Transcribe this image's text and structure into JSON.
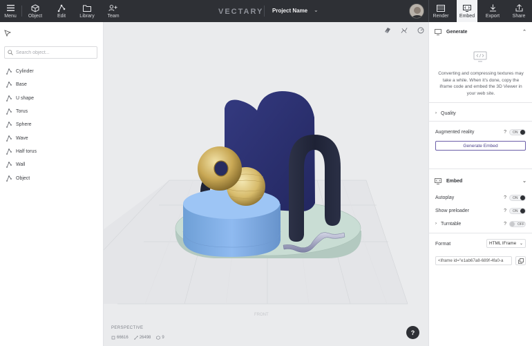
{
  "toolbar": {
    "menu_label": "Menu",
    "object_label": "Object",
    "edit_label": "Edit",
    "library_label": "Library",
    "team_label": "Team",
    "logo": "VECTARY",
    "project_name": "Project Name",
    "render_label": "Render",
    "embed_label": "Embed",
    "export_label": "Export",
    "share_label": "Share"
  },
  "left_panel": {
    "search_placeholder": "Search object...",
    "objects": [
      {
        "label": "Cylinder"
      },
      {
        "label": "Base"
      },
      {
        "label": "U shape"
      },
      {
        "label": "Torus"
      },
      {
        "label": "Sphere"
      },
      {
        "label": "Wave"
      },
      {
        "label": "Half torus"
      },
      {
        "label": "Wall"
      },
      {
        "label": "Object"
      }
    ]
  },
  "viewport": {
    "camera": "PERSPECTIVE",
    "front_label": "FRONT",
    "stats": {
      "vertices": "66616",
      "edges": "26498",
      "objects": "9"
    },
    "help_label": "?"
  },
  "right_panel": {
    "generate": {
      "title": "Generate",
      "description": "Converting and compressing textures may take a while. When it's done, copy the iframe code and embed the 3D Viewer in your web site.",
      "quality_label": "Quality",
      "ar_label": "Augmented reality",
      "ar_state": "ON",
      "help": "?",
      "button_label": "Generate Embed"
    },
    "embed": {
      "title": "Embed",
      "autoplay_label": "Autoplay",
      "autoplay_state": "ON",
      "preloader_label": "Show preloader",
      "preloader_state": "ON",
      "turntable_label": "Turntable",
      "turntable_state": "OFF",
      "help": "?",
      "format_label": "Format",
      "format_value": "HTML IFrame",
      "code_value": "<iframe id=\"e1ab67a8-689f-4fa0-a"
    }
  },
  "colors": {
    "toolbar_bg": "#2e3035",
    "viewport_bg": "#eaebed",
    "accent": "#6b5ea8"
  }
}
